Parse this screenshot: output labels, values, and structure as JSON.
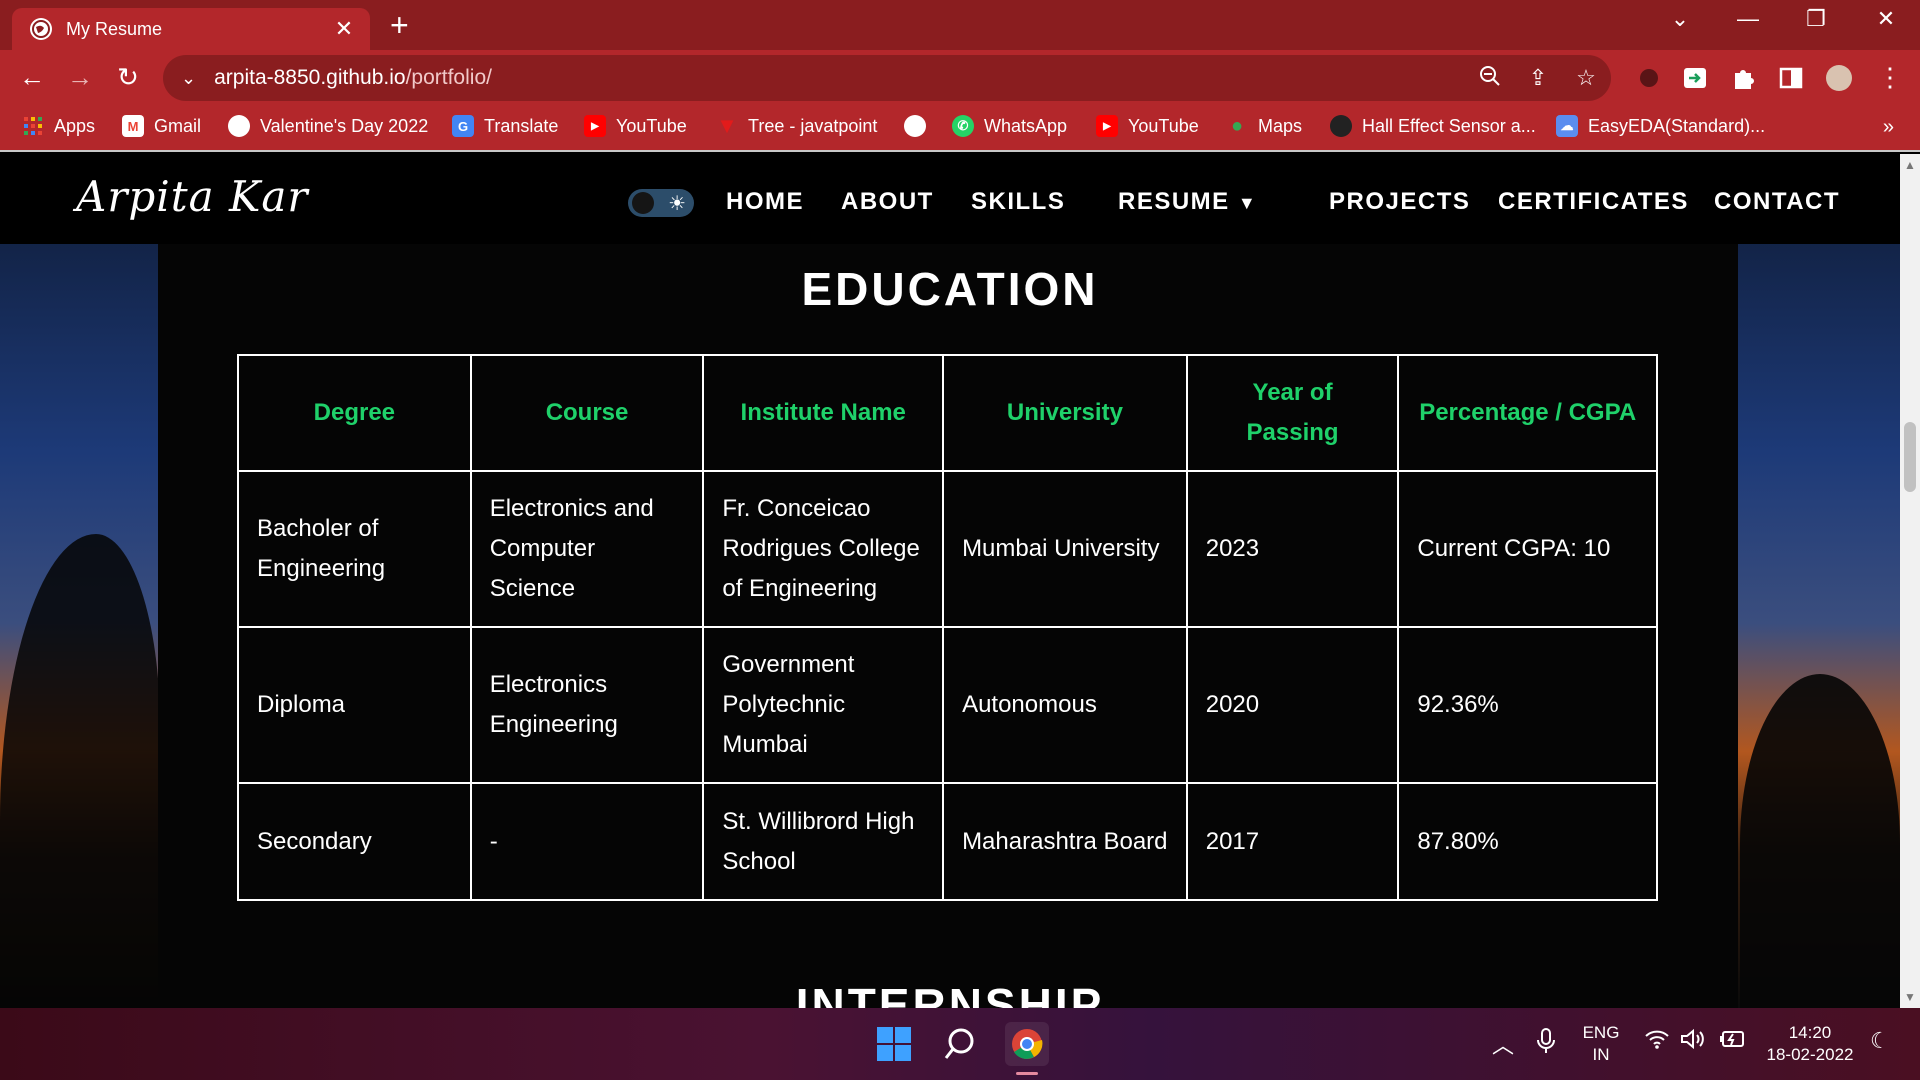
{
  "browser": {
    "tab_title": "My Resume",
    "url_host": "arpita-8850.github.io",
    "url_path": "/portfolio/",
    "bookmarks": [
      {
        "label": "Apps",
        "icon": "apps-grid-icon",
        "color": "#ffffff"
      },
      {
        "label": "Gmail",
        "icon": "gmail-icon",
        "color": "#ea4335"
      },
      {
        "label": "Valentine's Day 2022",
        "icon": "globe-icon",
        "color": "#ffffff"
      },
      {
        "label": "Translate",
        "icon": "translate-icon",
        "color": "#4285f4"
      },
      {
        "label": "YouTube",
        "icon": "youtube-icon",
        "color": "#ff0000"
      },
      {
        "label": "Tree - javatpoint",
        "icon": "javatpoint-icon",
        "color": "#e21b1b"
      },
      {
        "label": "",
        "icon": "globe-icon",
        "color": "#ffffff"
      },
      {
        "label": "WhatsApp",
        "icon": "whatsapp-icon",
        "color": "#25d366"
      },
      {
        "label": "YouTube",
        "icon": "youtube-icon",
        "color": "#ff0000"
      },
      {
        "label": "Maps",
        "icon": "maps-icon",
        "color": "#34a853"
      },
      {
        "label": "Hall Effect Sensor a...",
        "icon": "site-icon",
        "color": "#222222"
      },
      {
        "label": "EasyEDA(Standard)...",
        "icon": "easyeda-icon",
        "color": "#5b8def"
      }
    ]
  },
  "site": {
    "logo": "Arpita Kar",
    "nav": {
      "home": "HOME",
      "about": "ABOUT",
      "skills": "SKILLS",
      "resume": "RESUME",
      "projects": "PROJECTS",
      "certificates": "CERTIFICATES",
      "contact": "CONTACT"
    },
    "education": {
      "title": "EDUCATION",
      "headers": [
        "Degree",
        "Course",
        "Institute Name",
        "University",
        "Year of Passing",
        "Percentage / CGPA"
      ],
      "rows": [
        [
          "Bacholer of Engineering",
          "Electronics and Computer Science",
          "Fr. Conceicao Rodrigues College of Engineering",
          "Mumbai University",
          "2023",
          "Current CGPA: 10"
        ],
        [
          "Diploma",
          "Electronics Engineering",
          "Government Polytechnic Mumbai",
          "Autonomous",
          "2020",
          "92.36%"
        ],
        [
          "Secondary",
          "-",
          "St. Willibrord High School",
          "Maharashtra Board",
          "2017",
          "87.80%"
        ]
      ]
    },
    "next_section_title": "INTERNSHIP"
  },
  "taskbar": {
    "lang_top": "ENG",
    "lang_bottom": "IN",
    "time": "14:20",
    "date": "18-02-2022"
  },
  "colors": {
    "tab_bar": "#8a1d1f",
    "toolbar": "#b3272b",
    "table_header": "#1fd16a",
    "nav_bg": "#000000"
  }
}
